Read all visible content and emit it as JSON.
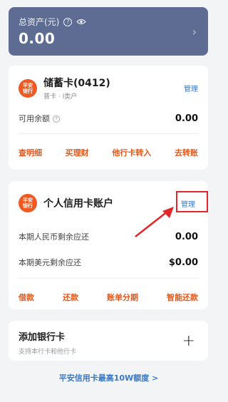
{
  "assets": {
    "label": "总资产(元)",
    "value": "0.00"
  },
  "debit_card": {
    "title": "储蓄卡(0412)",
    "subtitle": "普卡 · I类户",
    "manage": "管理",
    "available_label": "可用余额",
    "available_value": "0.00",
    "actions": [
      "查明细",
      "买理财",
      "他行卡转入",
      "去转账"
    ]
  },
  "credit_card": {
    "logo_text": "平安银行",
    "title": "个人信用卡账户",
    "manage": "管理",
    "rmb_label": "本期人民币剩余应还",
    "rmb_value": "0.00",
    "usd_label": "本期美元剩余应还",
    "usd_value": "$0.00",
    "actions": [
      "借款",
      "还款",
      "账单分期",
      "智能还款"
    ]
  },
  "add_card": {
    "title": "添加银行卡",
    "subtitle": "支持本行卡和他行卡"
  },
  "promo": {
    "text": "平安信用卡最高10W额度 >"
  },
  "colors": {
    "asset_bg": "#5e6b93",
    "accent": "#e2581c",
    "link": "#3a78c4",
    "annotation": "#e3262b"
  }
}
